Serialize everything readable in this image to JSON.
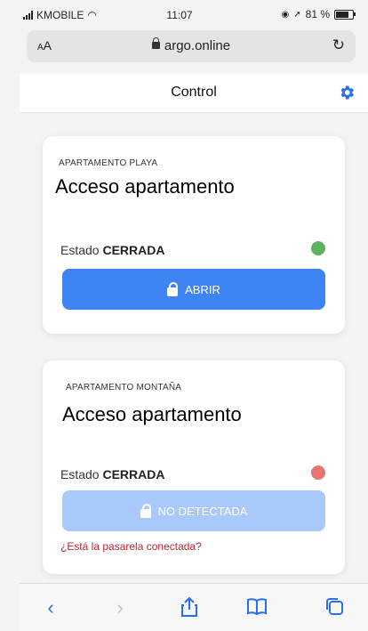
{
  "status_bar": {
    "carrier": "KMOBILE",
    "time": "11:07",
    "battery": "81 %"
  },
  "browser": {
    "text_size": "AA",
    "url": "argo.online"
  },
  "app": {
    "title": "Control"
  },
  "devices": [
    {
      "location": "APARTAMENTO PLAYA",
      "name": "Acceso apartamento",
      "state_label": "Estado",
      "state_value": "CERRADA",
      "status_color": "#5db35d",
      "action_label": "ABRIR"
    },
    {
      "location": "APARTAMENTO MONTAÑA",
      "name": "Acceso apartamento",
      "state_label": "Estado",
      "state_value": "CERRADA",
      "status_color": "#e97373",
      "action_label": "NO DETECTADA",
      "warning": "¿Está la pasarela conectada?"
    }
  ],
  "colors": {
    "primary": "#3f84f3",
    "primary_disabled": "#a9c9fa",
    "error": "#c0262d"
  },
  "toolbar_icons": [
    "back-icon",
    "forward-icon",
    "share-icon",
    "bookmarks-icon",
    "tabs-icon"
  ]
}
